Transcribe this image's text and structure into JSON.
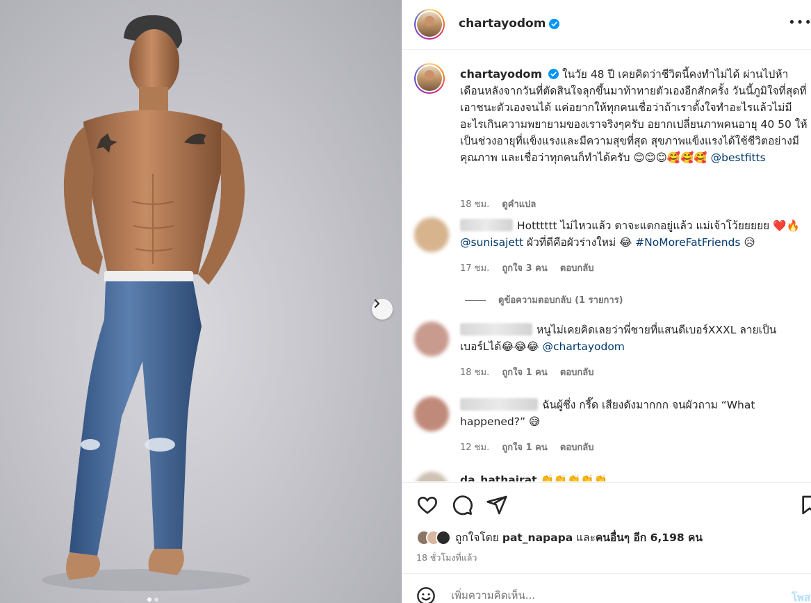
{
  "post": {
    "username": "chartayodom",
    "caption_text": "ในวัย 48 ปี เคยคิดว่าชีวิตนี้คงทำไม่ได้ ผ่านไปห้าเดือนหลังจากวันที่ตัดสินใจลุกขึ้นมาท้าทายตัวเองอีกสักครั้ง วันนี้ภูมิใจที่สุดที่เอาชนะตัวเองจนได้ แค่อยากให้ทุกคนเชื่อว่าถ้าเราตั้งใจทำอะไรแล้วไม่มีอะไรเกินความพยายามของเราจริงๆครับ อยากเปลี่ยนภาพคนอายุ 40 50 ให้เป็นช่วงอายุที่แข็งแรงและมีความสุขที่สุด สุขภาพแข็งแรงได้ใช้ชีวิตอย่างมีคุณภาพ และเชื่อว่าทุกคนก็ทำได้ครับ 😊😊😊🥰🥰🥰",
    "caption_mention": "@bestfitts",
    "caption_time": "18 ชม.",
    "translate_label": "ดูคำแปล"
  },
  "comments": [
    {
      "text_pre": "Hotttttt ไม่ไหวแล้ว ตาจะแตกอยู่แล้ว แม่เจ้าโว้ยยยยย ❤️🔥",
      "mention": "@sunisajett",
      "text_mid": " ผัวที่ดีคือผัวร่างใหม่ 😂 ",
      "hashtag": "#NoMoreFatFriends",
      "text_post": " 😥",
      "time": "17 ชม.",
      "likes": "ถูกใจ 3 คน",
      "reply": "ตอบกลับ"
    },
    {
      "text_pre": "หนูไม่เคยคิดเลยว่าพี่ชายที่แสนดีเบอร์XXXL ลายเป็นเบอร์Lได้😂😂😂 ",
      "mention": "@chartayodom",
      "time": "18 ชม.",
      "likes": "ถูกใจ 1 คน",
      "reply": "ตอบกลับ"
    },
    {
      "text_pre": "ฉันผู้ซึ่ง กรี๊ด เสียงดังมากกก จนผัวถาม “What happened?” 😅",
      "time": "12 ชม.",
      "likes": "ถูกใจ 1 คน",
      "reply": "ตอบกลับ"
    },
    {
      "username": "da_hathairat",
      "text_pre": "👏👏👏👏👏"
    }
  ],
  "view_replies": "ดูข้อความตอบกลับ (1 รายการ)",
  "likes": {
    "prefix": "ถูกใจโดย",
    "user": "pat_napapa",
    "conj": "และ",
    "others": "คนอื่นๆ อีก 6,198 คน"
  },
  "time_ago": "18 ชั่วโมงที่แล้ว",
  "add_comment": {
    "placeholder": "เพิ่มความคิดเห็น...",
    "post_label": "โพสต์"
  },
  "colors": {
    "link": "#00376b",
    "verified": "#0095f6",
    "muted": "#737373",
    "post_disabled": "#b2dffc"
  },
  "icons": [
    "verified-badge-icon",
    "more-options-icon",
    "heart-icon",
    "comment-icon",
    "share-icon",
    "bookmark-icon",
    "emoji-icon",
    "chevron-right-icon"
  ]
}
